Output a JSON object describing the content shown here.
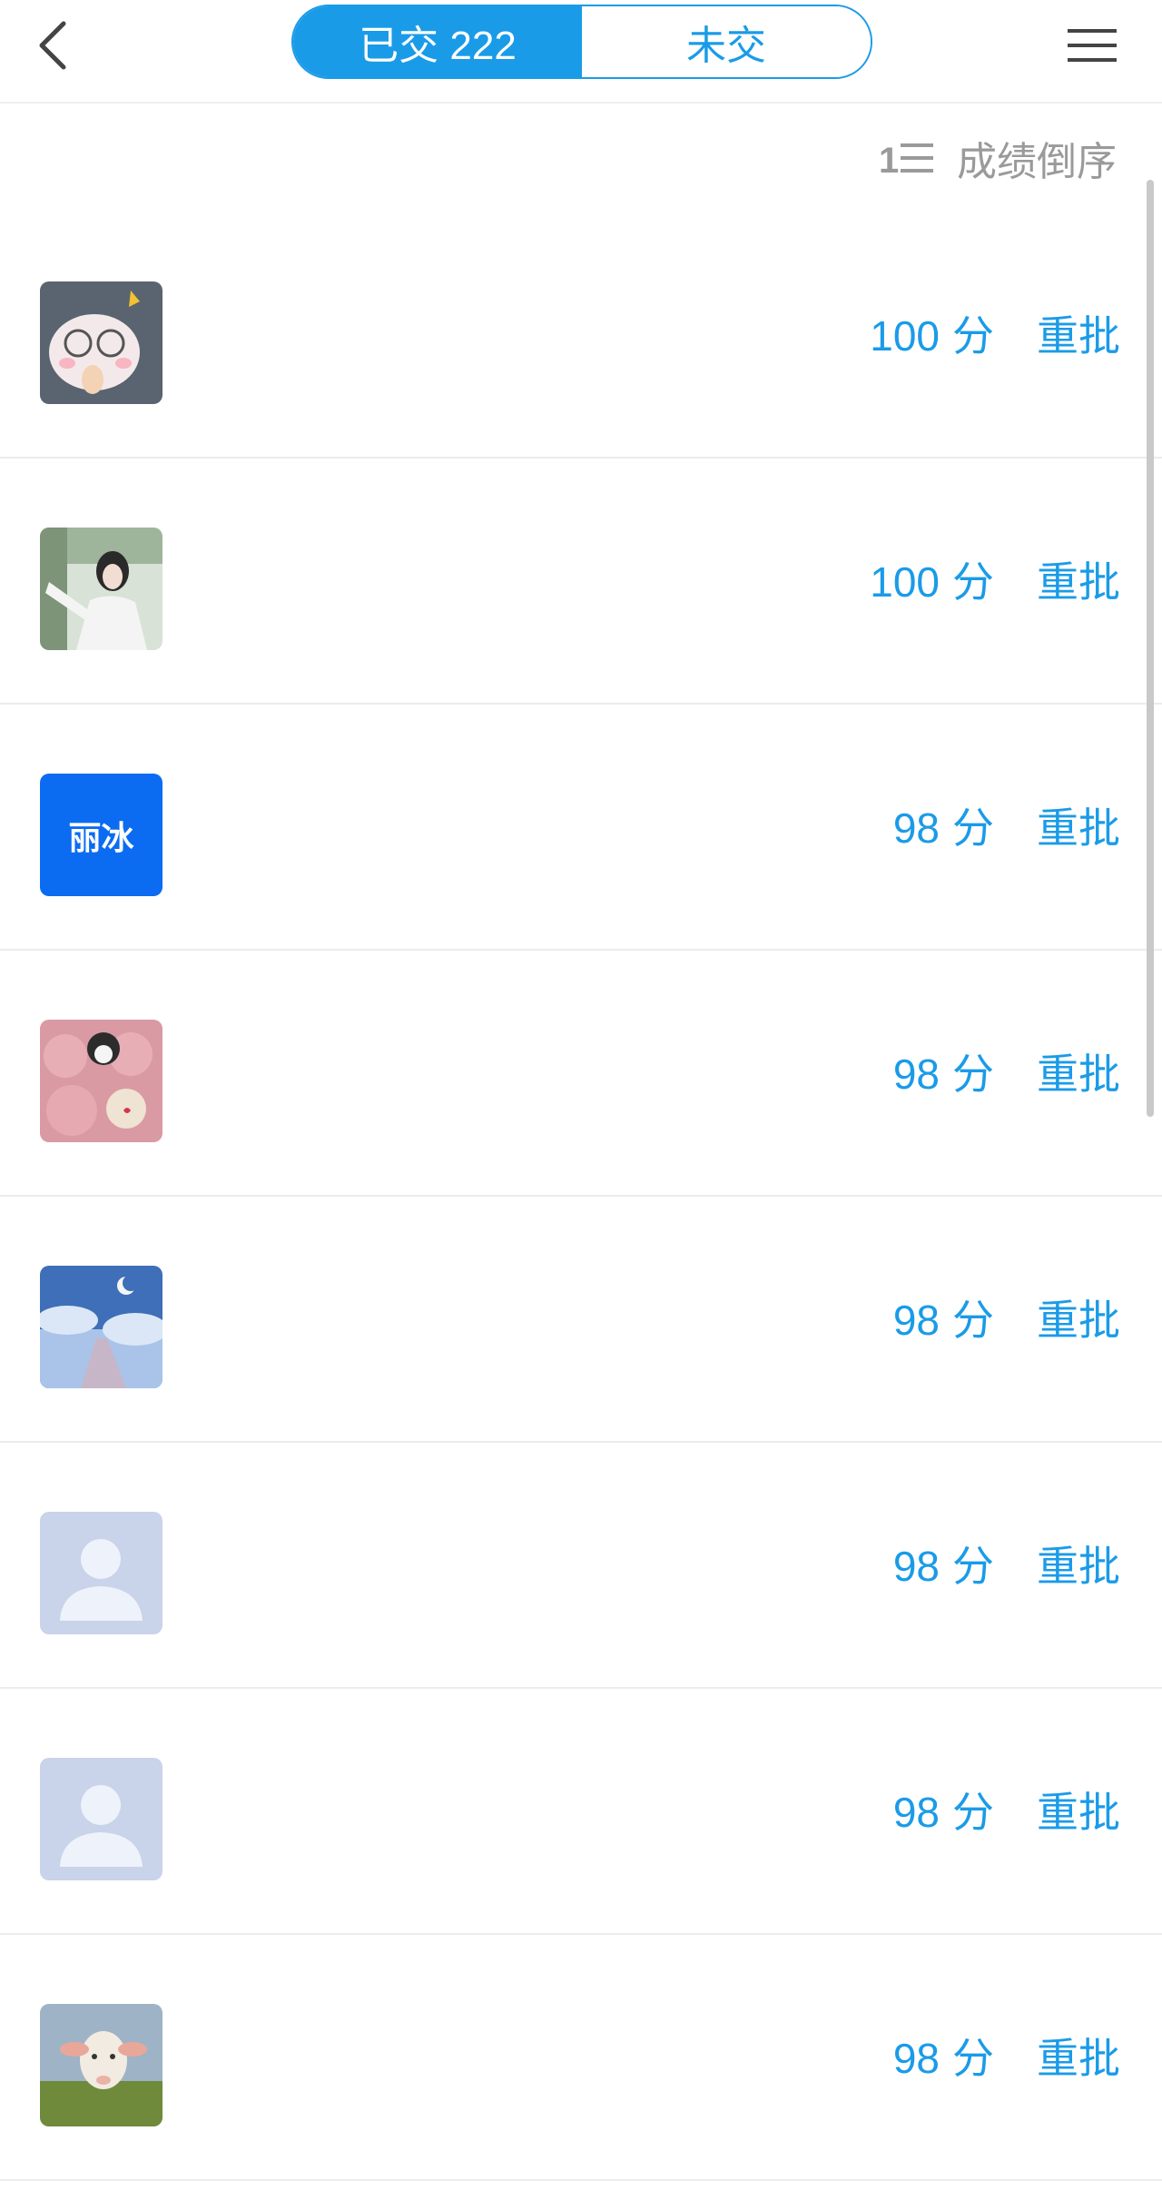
{
  "header": {
    "back_icon": "chevron-left-icon",
    "tabs": [
      {
        "label": "已交 222",
        "active": true
      },
      {
        "label": "未交",
        "active": false
      }
    ],
    "menu_icon": "hamburger-menu-icon"
  },
  "sort": {
    "icon": "sort-list-icon",
    "label": "成绩倒序"
  },
  "colors": {
    "accent": "#1a9be8",
    "muted": "#9a9a9a"
  },
  "students": [
    {
      "avatar": "cartoon-pig-avatar",
      "score": "100",
      "unit": "分",
      "action": "重批"
    },
    {
      "avatar": "photo-girl-avatar",
      "score": "100",
      "unit": "分",
      "action": "重批"
    },
    {
      "avatar": "text-avatar",
      "avatar_text": "丽冰",
      "score": "98",
      "unit": "分",
      "action": "重批"
    },
    {
      "avatar": "plush-toys-avatar",
      "score": "98",
      "unit": "分",
      "action": "重批"
    },
    {
      "avatar": "night-sky-avatar",
      "score": "98",
      "unit": "分",
      "action": "重批"
    },
    {
      "avatar": "default-user-avatar",
      "score": "98",
      "unit": "分",
      "action": "重批"
    },
    {
      "avatar": "default-user-avatar",
      "score": "98",
      "unit": "分",
      "action": "重批"
    },
    {
      "avatar": "lamb-avatar",
      "score": "98",
      "unit": "分",
      "action": "重批"
    }
  ]
}
